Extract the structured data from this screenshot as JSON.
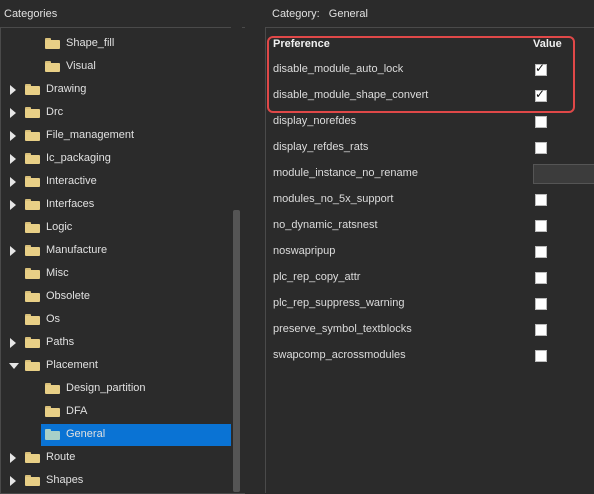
{
  "left_panel": {
    "title": "Categories",
    "items": [
      {
        "label": "Shape_fill",
        "indent": 1,
        "expander": "none",
        "selected": false
      },
      {
        "label": "Visual",
        "indent": 1,
        "expander": "none",
        "selected": false
      },
      {
        "label": "Drawing",
        "indent": 0,
        "expander": "collapsed",
        "selected": false
      },
      {
        "label": "Drc",
        "indent": 0,
        "expander": "collapsed",
        "selected": false
      },
      {
        "label": "File_management",
        "indent": 0,
        "expander": "collapsed",
        "selected": false
      },
      {
        "label": "Ic_packaging",
        "indent": 0,
        "expander": "collapsed",
        "selected": false
      },
      {
        "label": "Interactive",
        "indent": 0,
        "expander": "collapsed",
        "selected": false
      },
      {
        "label": "Interfaces",
        "indent": 0,
        "expander": "collapsed",
        "selected": false
      },
      {
        "label": "Logic",
        "indent": 0,
        "expander": "none",
        "selected": false
      },
      {
        "label": "Manufacture",
        "indent": 0,
        "expander": "collapsed",
        "selected": false
      },
      {
        "label": "Misc",
        "indent": 0,
        "expander": "none",
        "selected": false
      },
      {
        "label": "Obsolete",
        "indent": 0,
        "expander": "none",
        "selected": false
      },
      {
        "label": "Os",
        "indent": 0,
        "expander": "none",
        "selected": false
      },
      {
        "label": "Paths",
        "indent": 0,
        "expander": "collapsed",
        "selected": false
      },
      {
        "label": "Placement",
        "indent": 0,
        "expander": "expanded",
        "selected": false
      },
      {
        "label": "Design_partition",
        "indent": 1,
        "expander": "none",
        "selected": false
      },
      {
        "label": "DFA",
        "indent": 1,
        "expander": "none",
        "selected": false
      },
      {
        "label": "General",
        "indent": 1,
        "expander": "none",
        "selected": true
      },
      {
        "label": "Route",
        "indent": 0,
        "expander": "collapsed",
        "selected": false
      },
      {
        "label": "Shapes",
        "indent": 0,
        "expander": "collapsed",
        "selected": false
      }
    ]
  },
  "right_panel": {
    "category_label": "Category:",
    "category_value": "General",
    "header_preference": "Preference",
    "header_value": "Value",
    "rows": [
      {
        "name": "disable_module_auto_lock",
        "type": "checkbox",
        "checked": true
      },
      {
        "name": "disable_module_shape_convert",
        "type": "checkbox",
        "checked": true
      },
      {
        "name": "display_norefdes",
        "type": "checkbox",
        "checked": false
      },
      {
        "name": "display_refdes_rats",
        "type": "checkbox",
        "checked": false
      },
      {
        "name": "module_instance_no_rename",
        "type": "text",
        "value": ""
      },
      {
        "name": "modules_no_5x_support",
        "type": "checkbox",
        "checked": false
      },
      {
        "name": "no_dynamic_ratsnest",
        "type": "checkbox",
        "checked": false
      },
      {
        "name": "noswapripup",
        "type": "checkbox",
        "checked": false
      },
      {
        "name": "plc_rep_copy_attr",
        "type": "checkbox",
        "checked": false
      },
      {
        "name": "plc_rep_suppress_warning",
        "type": "checkbox",
        "checked": false
      },
      {
        "name": "preserve_symbol_textblocks",
        "type": "checkbox",
        "checked": false
      },
      {
        "name": "swapcomp_acrossmodules",
        "type": "checkbox",
        "checked": false
      }
    ],
    "check_glyph": "✓"
  },
  "colors": {
    "background": "#2b2b2b",
    "selection": "#0a73d4",
    "folder": "#e8cf86",
    "selected_folder": "#a8d0c8",
    "highlight": "#e04848"
  }
}
